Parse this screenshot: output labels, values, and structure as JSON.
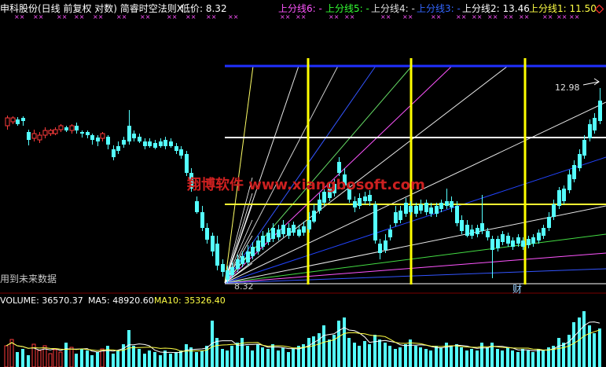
{
  "header": {
    "title": "申科股份(日线 前复权 对数) 简睿时空法则X",
    "low_label": "低价: 8.32",
    "lines": [
      {
        "label": "上分线6: -",
        "color": "#ff55ff"
      },
      {
        "label": "上分线5: -",
        "color": "#33ff33"
      },
      {
        "label": "上分线4: -",
        "color": "#e0e0e0"
      },
      {
        "label": "上分线3: -",
        "color": "#3366ff"
      },
      {
        "label": "上分线2: 13.46",
        "color": "#ffffff"
      },
      {
        "label": "上分线1: 11.50",
        "color": "#ffff44"
      }
    ],
    "close_icon": "diamond-icon"
  },
  "volume_header": {
    "volume": "VOLUME: 36570.37",
    "ma5": "MA5: 48920.60",
    "ma10": "MA10: 35326.40"
  },
  "annotations": {
    "future_data": "用到未来数据",
    "low_price": "8.32",
    "high_price": "12.98",
    "cai": "财",
    "watermark": "翔博软件 www.xiangbosoft.com"
  },
  "colors": {
    "up": "#ff3c3c",
    "down": "#54ffff",
    "grid_blue": "#0000ff",
    "vline_yellow": "#ffff00",
    "hline_white": "#ffffff",
    "hline_yellow": "#ffff00"
  }
}
